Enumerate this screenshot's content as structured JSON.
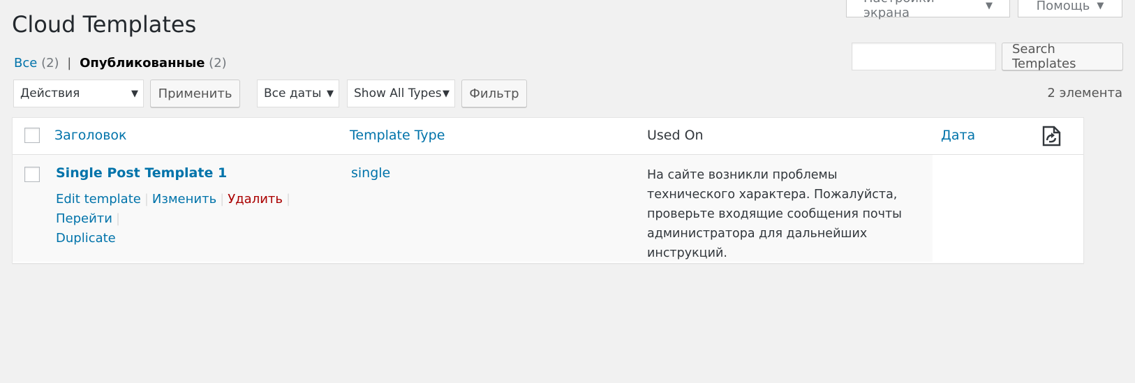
{
  "screen_meta": {
    "screen_options": "Настройки экрана",
    "help": "Помощь"
  },
  "page": {
    "title": "Cloud Templates"
  },
  "views": {
    "all_label": "Все",
    "all_count": "(2)",
    "separator": "|",
    "published_label": "Опубликованные",
    "published_count": "(2)"
  },
  "search": {
    "input_value": "",
    "button_label": "Search Templates"
  },
  "tablenav": {
    "bulk_action_selected": "Действия",
    "apply_label": "Применить",
    "dates_selected": "Все даты",
    "types_selected": "Show All Types",
    "filter_label": "Фильтр",
    "items_count": "2 элемента"
  },
  "table": {
    "columns": {
      "title": "Заголовок",
      "template_type": "Template Type",
      "used_on": "Used On",
      "date": "Дата"
    },
    "rows": [
      {
        "title": "Single Post Template 1",
        "actions": {
          "edit_template": "Edit template",
          "edit": "Изменить",
          "delete": "Удалить",
          "view": "Перейти",
          "duplicate": "Duplicate"
        },
        "template_type": "single",
        "used_on": "На сайте возникли проблемы технического характера. Пожалуйста, проверьте входящие сообщения почты администратора для дальнейших инструкций.",
        "date": ""
      }
    ]
  },
  "icons": {
    "dropdown": "triangle-down-icon",
    "column_sync": "sync-document-icon"
  },
  "colors": {
    "link": "#0073aa",
    "delete": "#aa0000",
    "background": "#f1f1f1"
  }
}
